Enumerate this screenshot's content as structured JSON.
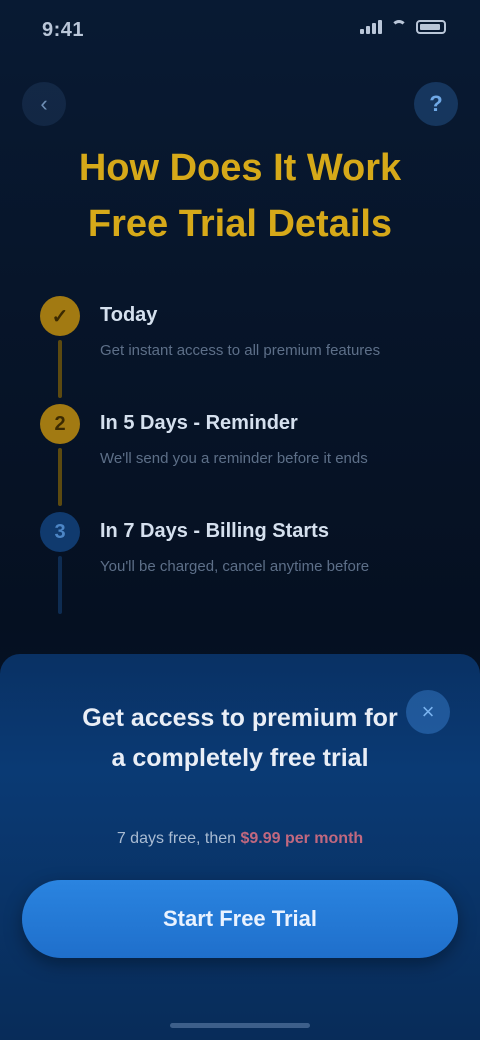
{
  "status_bar": {
    "time": "9:41",
    "icons": [
      "signal-icon",
      "wifi-icon",
      "battery-icon"
    ]
  },
  "nav": {
    "back_icon": "‹",
    "help_icon": "?"
  },
  "title": {
    "line1": "How Does It Work",
    "line2": "Free Trial Details"
  },
  "steps": [
    {
      "number": "✓",
      "title": "Today",
      "description": "Get instant access to all premium features",
      "state": "done"
    },
    {
      "number": "2",
      "title": "In 5 Days - Reminder",
      "description": "We'll send you a reminder before it ends",
      "state": "done"
    },
    {
      "number": "3",
      "title": "In 7 Days - Billing Starts",
      "description": "You'll be charged, cancel anytime before",
      "state": "pending"
    }
  ],
  "sheet": {
    "close_icon": "×",
    "heading": "Get access to premium for a completely free trial",
    "note_prefix": "7 days free, then ",
    "note_link": "$9.99 per month",
    "cta_label": "Start Free Trial"
  },
  "colors": {
    "accent_gold": "#d6a919",
    "accent_blue": "#2a84e0",
    "background": "#061224",
    "note_link": "#c1687f"
  }
}
